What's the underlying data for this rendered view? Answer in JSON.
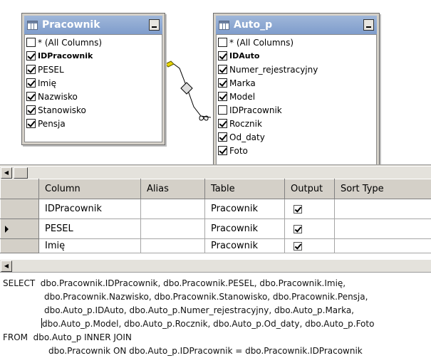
{
  "diagram": {
    "tables": [
      {
        "title": "Pracownik",
        "icon": "table-icon",
        "columns": [
          {
            "label": "* (All Columns)",
            "checked": false,
            "key": false
          },
          {
            "label": "IDPracownik",
            "checked": true,
            "key": true
          },
          {
            "label": "PESEL",
            "checked": true,
            "key": false
          },
          {
            "label": "Imię",
            "checked": true,
            "key": false
          },
          {
            "label": "Nazwisko",
            "checked": true,
            "key": false
          },
          {
            "label": "Stanowisko",
            "checked": true,
            "key": false
          },
          {
            "label": "Pensja",
            "checked": true,
            "key": false
          }
        ]
      },
      {
        "title": "Auto_p",
        "icon": "table-icon",
        "columns": [
          {
            "label": "* (All Columns)",
            "checked": false,
            "key": false
          },
          {
            "label": "IDAuto",
            "checked": true,
            "key": true
          },
          {
            "label": "Numer_rejestracyjny",
            "checked": true,
            "key": false
          },
          {
            "label": "Marka",
            "checked": true,
            "key": false
          },
          {
            "label": "Model",
            "checked": true,
            "key": false
          },
          {
            "label": "IDPracownik",
            "checked": false,
            "key": false
          },
          {
            "label": "Rocznik",
            "checked": true,
            "key": false
          },
          {
            "label": "Od_daty",
            "checked": true,
            "key": false
          },
          {
            "label": "Foto",
            "checked": true,
            "key": false
          }
        ]
      }
    ]
  },
  "grid": {
    "headers": [
      "Column",
      "Alias",
      "Table",
      "Output",
      "Sort Type"
    ],
    "rows": [
      {
        "column": "IDPracownik",
        "alias": "",
        "table": "Pracownik",
        "output": true,
        "current": false
      },
      {
        "column": "PESEL",
        "alias": "",
        "table": "Pracownik",
        "output": true,
        "current": true
      },
      {
        "column": "Imię",
        "alias": "",
        "table": "Pracownik",
        "output": true,
        "current": false
      }
    ]
  },
  "sql": {
    "lines": [
      "SELECT  dbo.Pracownik.IDPracownik, dbo.Pracownik.PESEL, dbo.Pracownik.Imię,",
      "dbo.Pracownik.Nazwisko, dbo.Pracownik.Stanowisko, dbo.Pracownik.Pensja,",
      "dbo.Auto_p.IDAuto, dbo.Auto_p.Numer_rejestracyjny, dbo.Auto_p.Marka,",
      "dbo.Auto_p.Model, dbo.Auto_p.Rocznik, dbo.Auto_p.Od_daty, dbo.Auto_p.Foto",
      "FROM  dbo.Auto_p INNER JOIN",
      "dbo.Pracownik ON dbo.Auto_p.IDPracownik = dbo.Pracownik.IDPracownik"
    ]
  }
}
